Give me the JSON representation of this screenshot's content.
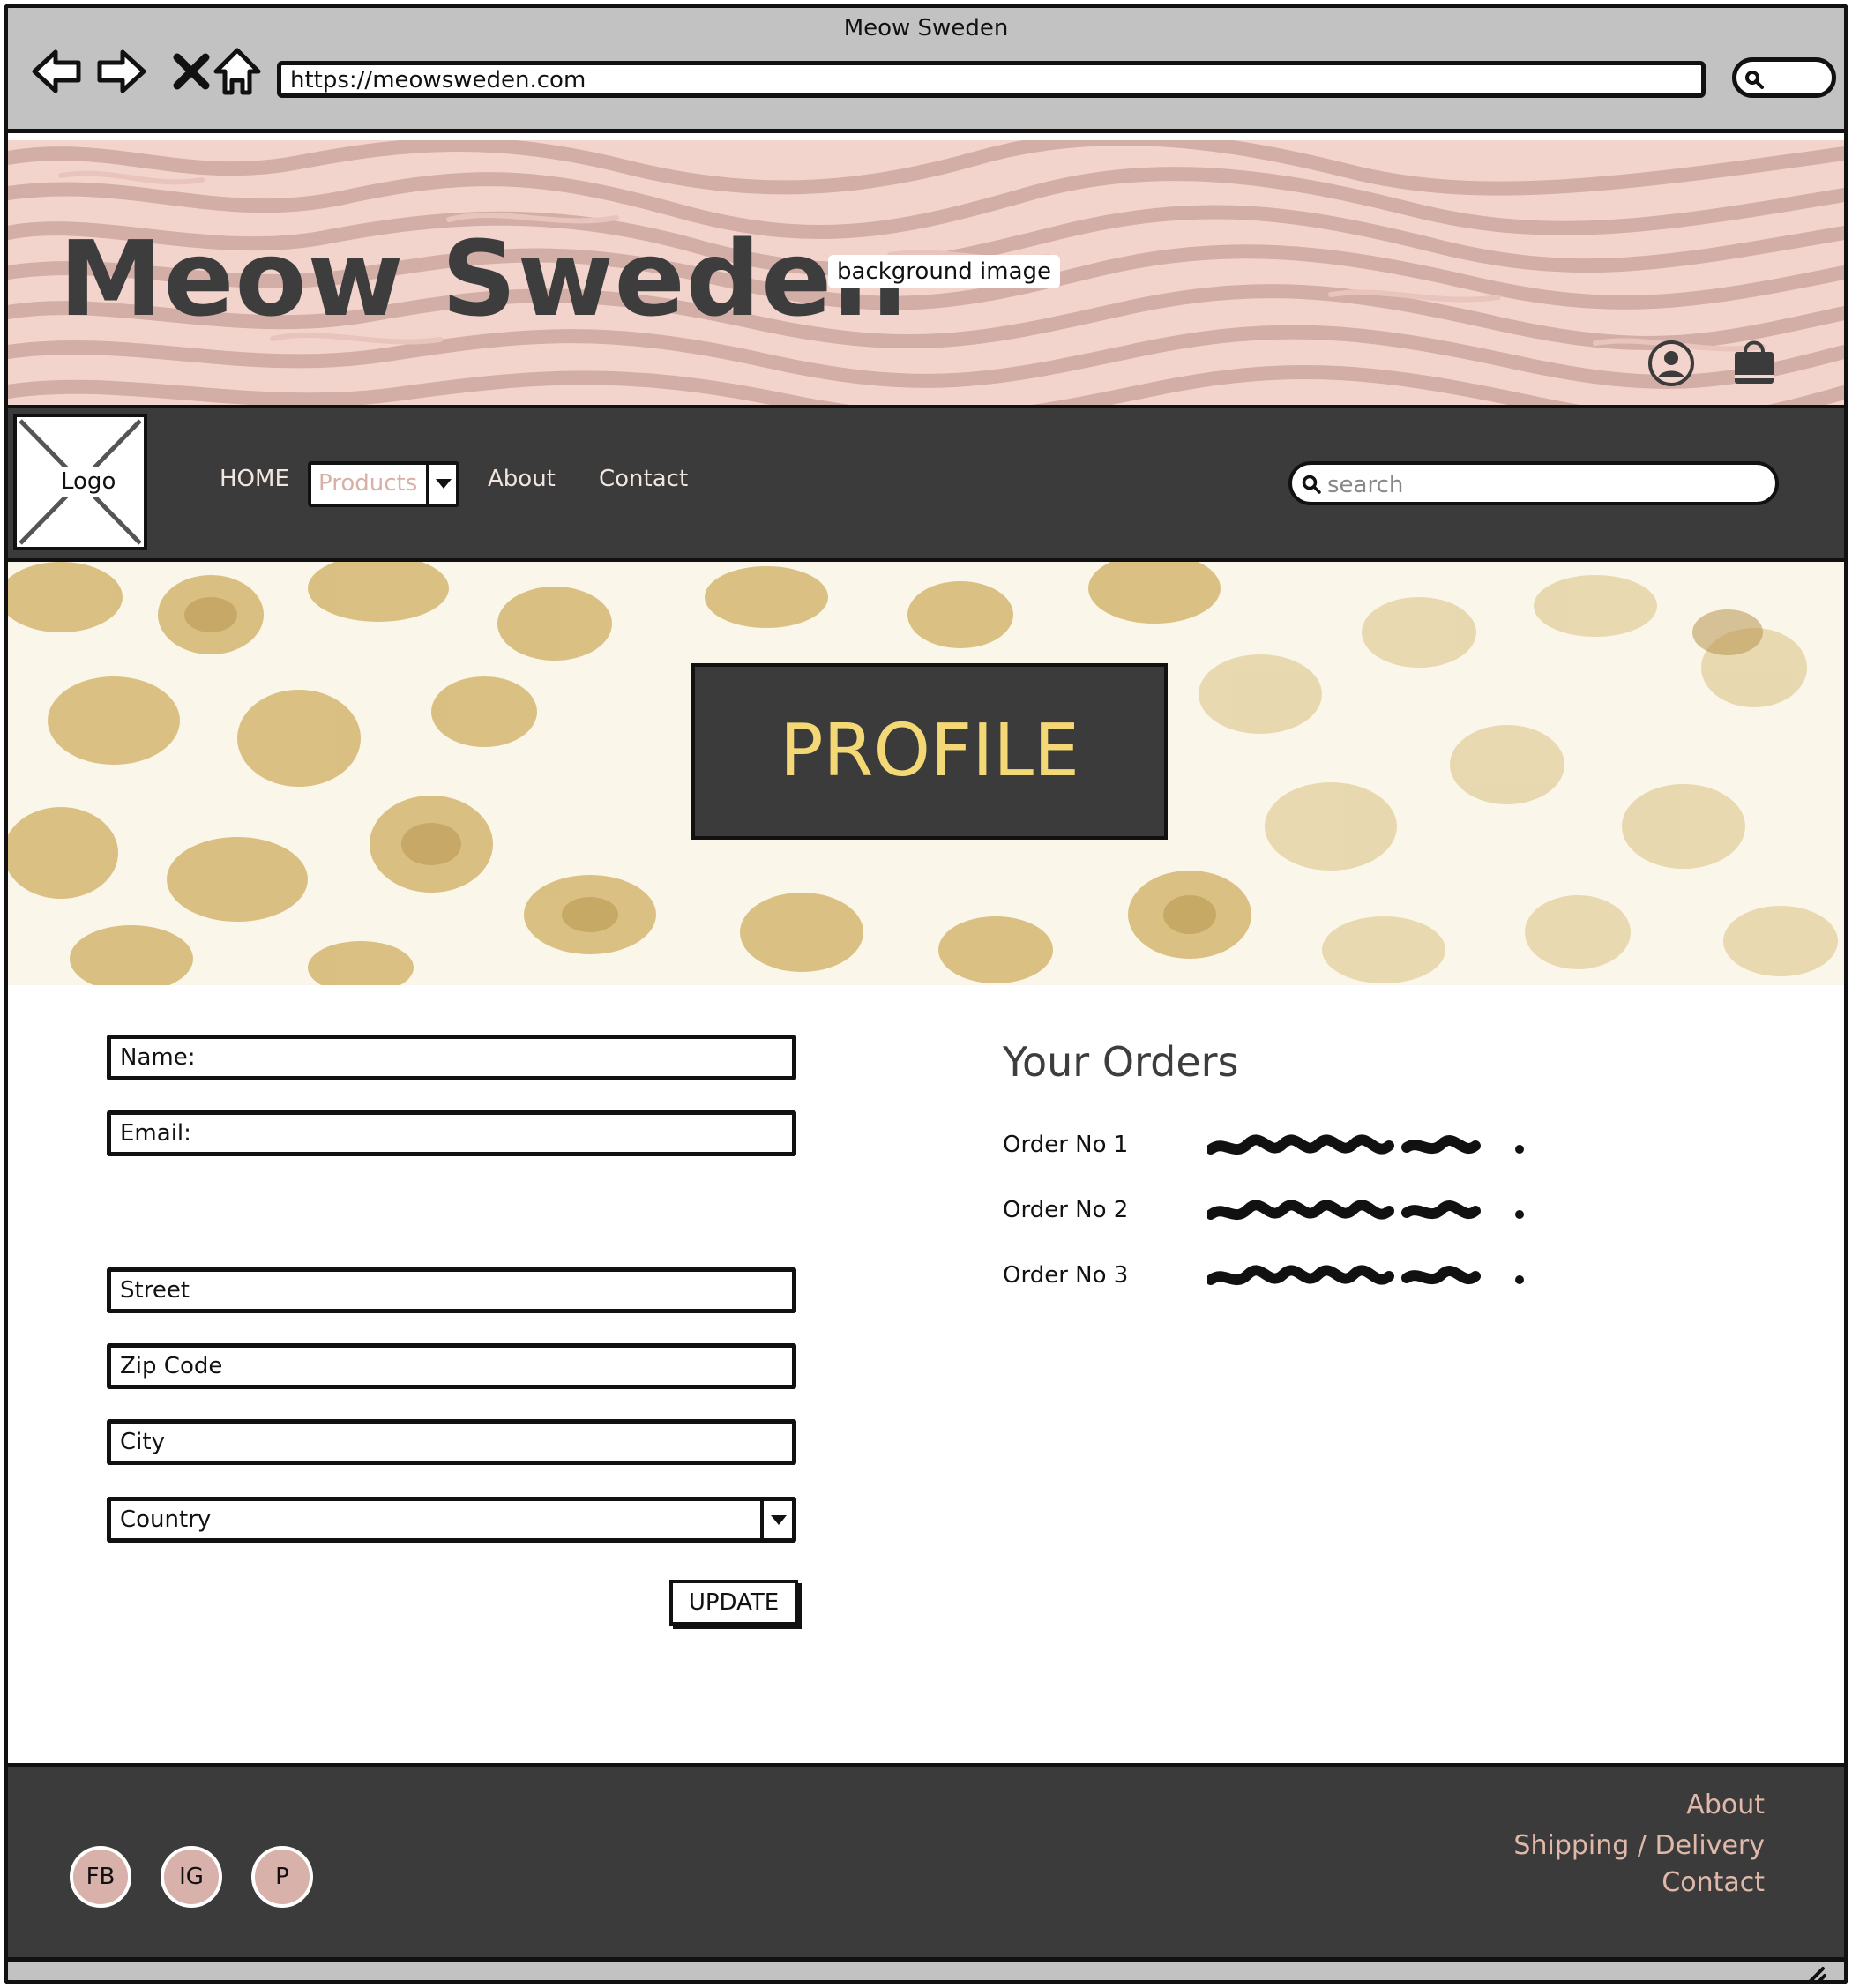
{
  "browser": {
    "window_title": "Meow Sweden",
    "url": "https://meowsweden.com"
  },
  "header": {
    "site_title": "Meow Sweden",
    "background_label": "background image",
    "icons": [
      "account-icon",
      "shopping-bag-icon"
    ]
  },
  "nav": {
    "logo_label": "Logo",
    "home": "HOME",
    "products": "Products",
    "about": "About",
    "contact": "Contact",
    "search_placeholder": "search"
  },
  "banner": {
    "title": "PROFILE"
  },
  "form": {
    "name_label": "Name:",
    "email_label": "Email:",
    "street_label": "Street",
    "zip_label": "Zip Code",
    "city_label": "City",
    "country_label": "Country",
    "update_label": "UPDATE"
  },
  "orders": {
    "title": "Your Orders",
    "items": [
      {
        "label": "Order No 1"
      },
      {
        "label": "Order No 2"
      },
      {
        "label": "Order No 3"
      }
    ]
  },
  "footer": {
    "social": [
      "FB",
      "IG",
      "P"
    ],
    "links": [
      "About",
      "Shipping / Delivery",
      "Contact"
    ]
  },
  "colors": {
    "dark": "#3b3b3b",
    "accent_pink": "#d9b1ab",
    "profile_gold": "#f4d875",
    "header_pink": "#f3d6cf"
  }
}
